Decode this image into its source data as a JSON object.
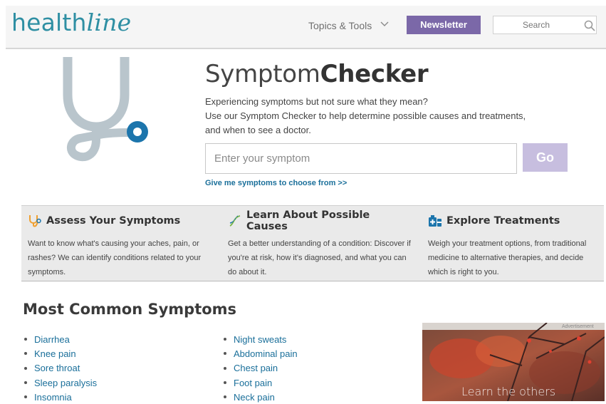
{
  "header": {
    "logo_prefix": "health",
    "logo_suffix": "line",
    "topics_label": "Topics & Tools",
    "newsletter_label": "Newsletter",
    "search_placeholder": "Search"
  },
  "hero": {
    "title_light": "Symptom",
    "title_bold": "Checker",
    "description_lines": [
      "Experiencing symptoms but not sure what they mean?",
      "Use our Symptom Checker to help determine possible causes and treatments,",
      "and when to see a doctor."
    ],
    "input_placeholder": "Enter your symptom",
    "go_label": "Go",
    "give_link": "Give me symptoms to choose from >>"
  },
  "features": [
    {
      "icon": "stethoscope-icon",
      "title": "Assess Your Symptoms",
      "text": "Want to know what's causing your aches, pain, or rashes? We can identify conditions related to your symptoms."
    },
    {
      "icon": "dna-icon",
      "title": "Learn About Possible Causes",
      "text": "Get a better understanding of a condition: Discover if you're at risk, how it's diagnosed, and what you can do about it."
    },
    {
      "icon": "medicine-kit-icon",
      "title": "Explore Treatments",
      "text": "Weigh your treatment options, from traditional medicine to alternative therapies, and decide which is right to you."
    }
  ],
  "most_common": {
    "title": "Most Common Symptoms",
    "column1": [
      "Diarrhea",
      "Knee pain",
      "Sore throat",
      "Sleep paralysis",
      "Insomnia"
    ],
    "column2": [
      "Night sweats",
      "Abdominal pain",
      "Chest pain",
      "Foot pain",
      "Neck pain"
    ]
  },
  "ad": {
    "label": "Advertisement",
    "text": "Learn the others"
  },
  "colors": {
    "brand_teal": "#2f8fa3",
    "newsletter_purple": "#7b68a8",
    "go_lavender": "#c7bedf",
    "link_blue": "#1a6f9a",
    "icon_orange": "#f0a030",
    "icon_blue": "#1c75ac"
  }
}
